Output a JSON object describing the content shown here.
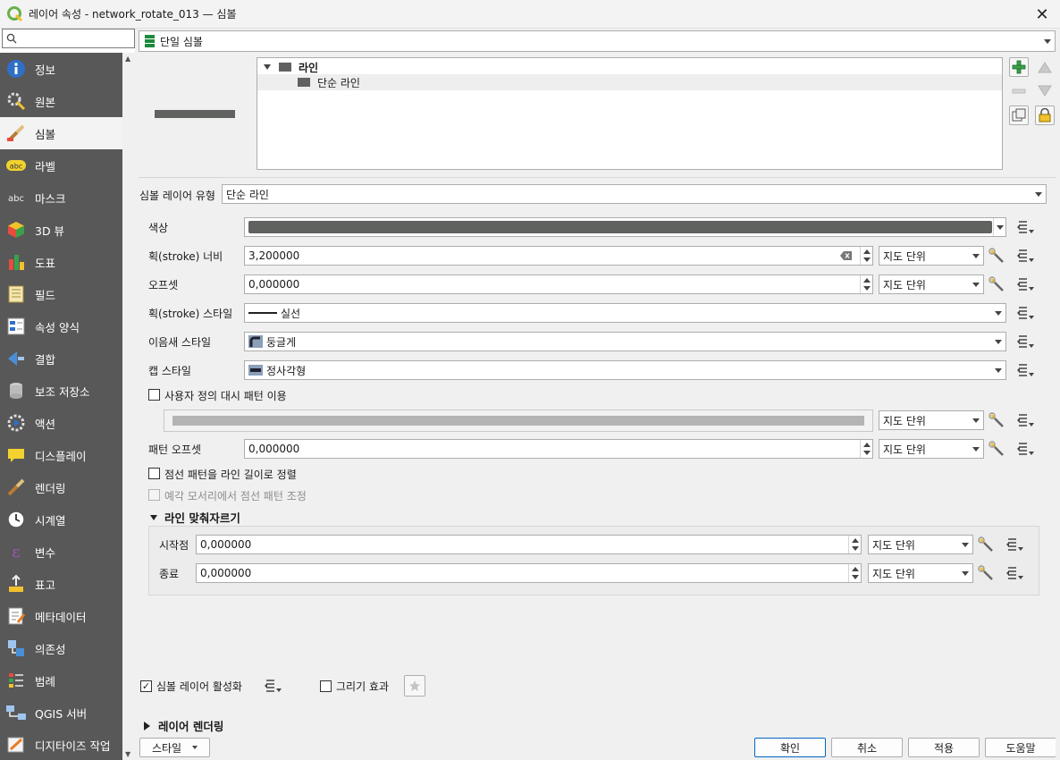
{
  "window": {
    "title": "레이어 속성 - network_rotate_013 — 심볼",
    "close_glyph": "✕"
  },
  "sidebar": {
    "search_placeholder": "",
    "items": [
      {
        "label": "정보",
        "icon": "info-icon"
      },
      {
        "label": "원본",
        "icon": "source-icon"
      },
      {
        "label": "심볼",
        "icon": "symbology-icon",
        "active": true
      },
      {
        "label": "라벨",
        "icon": "labels-icon"
      },
      {
        "label": "마스크",
        "icon": "masks-icon"
      },
      {
        "label": "3D 뷰",
        "icon": "3d-view-icon"
      },
      {
        "label": "도표",
        "icon": "diagrams-icon"
      },
      {
        "label": "필드",
        "icon": "fields-icon"
      },
      {
        "label": "속성 양식",
        "icon": "attributes-form-icon"
      },
      {
        "label": "결합",
        "icon": "joins-icon"
      },
      {
        "label": "보조 저장소",
        "icon": "auxiliary-storage-icon"
      },
      {
        "label": "액션",
        "icon": "actions-icon"
      },
      {
        "label": "디스플레이",
        "icon": "display-icon"
      },
      {
        "label": "렌더링",
        "icon": "rendering-icon"
      },
      {
        "label": "시계열",
        "icon": "temporal-icon"
      },
      {
        "label": "변수",
        "icon": "variables-icon"
      },
      {
        "label": "표고",
        "icon": "elevation-icon"
      },
      {
        "label": "메타데이터",
        "icon": "metadata-icon"
      },
      {
        "label": "의존성",
        "icon": "dependencies-icon"
      },
      {
        "label": "범례",
        "icon": "legend-icon"
      },
      {
        "label": "QGIS 서버",
        "icon": "qgis-server-icon"
      },
      {
        "label": "디지타이즈 작업",
        "icon": "digitizing-icon"
      }
    ]
  },
  "renderer": {
    "value": "단일 심볼"
  },
  "symbol_tree": {
    "root": "라인",
    "child": "단순 라인"
  },
  "symbol_color": "#5f625f",
  "layer_type": {
    "label": "심볼 레이어 유형",
    "value": "단순 라인"
  },
  "props": {
    "color_label": "색상",
    "stroke_width_label": "획(stroke) 너비",
    "stroke_width_value": "3,200000",
    "offset_label": "오프셋",
    "offset_value": "0,000000",
    "stroke_style_label": "획(stroke) 스타일",
    "stroke_style_value": "실선",
    "join_style_label": "이음새 스타일",
    "join_style_value": "둥글게",
    "cap_style_label": "캡 스타일",
    "cap_style_value": "정사각형",
    "custom_dash_label": "사용자 정의 대시 패턴 이용",
    "pattern_offset_label": "패턴 오프셋",
    "pattern_offset_value": "0,000000",
    "align_dash_label": "점선 패턴을 라인 길이로 정렬",
    "tweak_dash_label": "예각 모서리에서 점선 패턴 조정",
    "unit": "지도 단위"
  },
  "trim": {
    "title": "라인 맞춰자르기",
    "start_label": "시작점",
    "start_value": "0,000000",
    "end_label": "종료",
    "end_value": "0,000000"
  },
  "footer": {
    "enable_layer_label": "심볼 레이어 활성화",
    "draw_effects_label": "그리기 효과",
    "layer_rendering_title": "레이어 렌더링",
    "style_btn": "스타일",
    "ok": "확인",
    "cancel": "취소",
    "apply": "적용",
    "help": "도움말"
  }
}
